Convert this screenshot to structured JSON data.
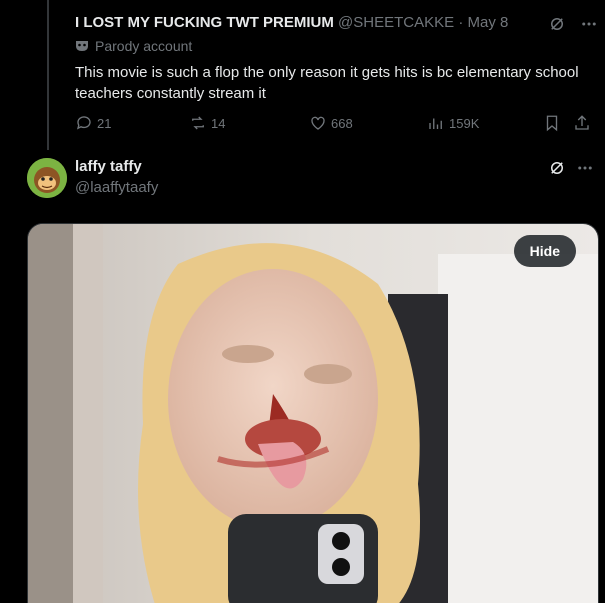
{
  "reply_tweet": {
    "display_name": "I LOST MY FUCKING TWT PREMIUM",
    "handle": "@SHEETCAKKE",
    "separator": "·",
    "date": "May 8",
    "parody_label": "Parody account",
    "text": "This movie is such a flop the only reason it gets hits is bc elementary school teachers constantly stream it",
    "replies": "21",
    "reposts": "14",
    "likes": "668",
    "views": "159K"
  },
  "quoted_tweet": {
    "display_name": "laffy taffy",
    "handle": "@laaffytaafy",
    "hide_label": "Hide"
  },
  "icons": {
    "grok": "grok-icon",
    "more": "more-icon",
    "reply": "reply-icon",
    "repost": "repost-icon",
    "like": "heart-icon",
    "views": "views-icon",
    "bookmark": "bookmark-icon",
    "share": "share-icon",
    "parody": "mask-icon"
  },
  "colors": {
    "background": "#000000",
    "text_primary": "#e7e9ea",
    "text_muted": "#71767b"
  }
}
